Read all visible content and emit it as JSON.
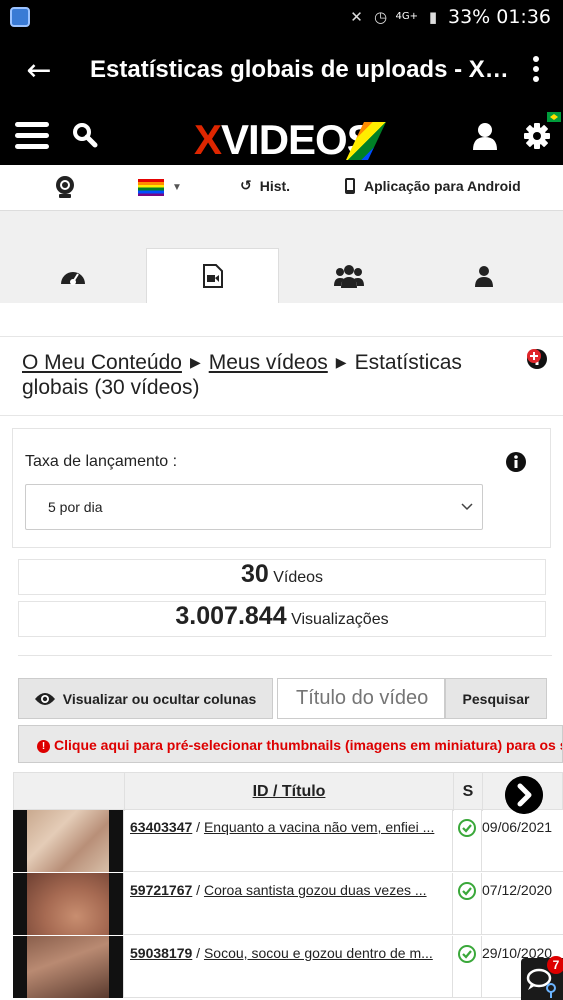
{
  "status_bar": {
    "battery": "33%",
    "time": "01:36",
    "network": "4G+"
  },
  "app_bar": {
    "title": "Estatísticas globais de uploads - XVI..."
  },
  "site_header": {
    "logo_x": "X",
    "logo_rest": "VIDEOS"
  },
  "subnav": {
    "hist_label": "Hist.",
    "android_label": "Aplicação para Android"
  },
  "tabs": [
    "dashboard",
    "videos",
    "groups",
    "profile"
  ],
  "breadcrumb": {
    "item1": "O Meu Conteúdo",
    "item2": "Meus vídeos",
    "current": "Estatísticas globais (30 vídeos)"
  },
  "rate": {
    "label": "Taxa de lançamento :",
    "selected": "5 por dia"
  },
  "stats": {
    "videos_count": "30",
    "videos_label": "Vídeos",
    "views_count": "3.007.844",
    "views_label": "Visualizações"
  },
  "toolbar": {
    "columns_button": "Visualizar ou ocultar colunas",
    "search_placeholder": "Título do vídeo",
    "search_button": "Pesquisar"
  },
  "notice": "Clique aqui para pré-selecionar thumbnails (imagens em miniatura) para os s",
  "table": {
    "header_id": "ID / Título",
    "header_s": "S",
    "rows": [
      {
        "id": "63403347",
        "title": "Enquanto a vacina não vem, enfiei ...",
        "date": "09/06/2021"
      },
      {
        "id": "59721767",
        "title": "Coroa santista gozou duas vezes ...",
        "date": "07/12/2020"
      },
      {
        "id": "59038179",
        "title": "Socou, socou e gozou dentro de m...",
        "date": "29/10/2020"
      }
    ]
  },
  "chat": {
    "badge": "7"
  },
  "colors": {
    "xvideos_red": "#de2600",
    "notice_red": "#dd0000",
    "check_green": "#3aa83a",
    "badge_red": "#d00000"
  }
}
